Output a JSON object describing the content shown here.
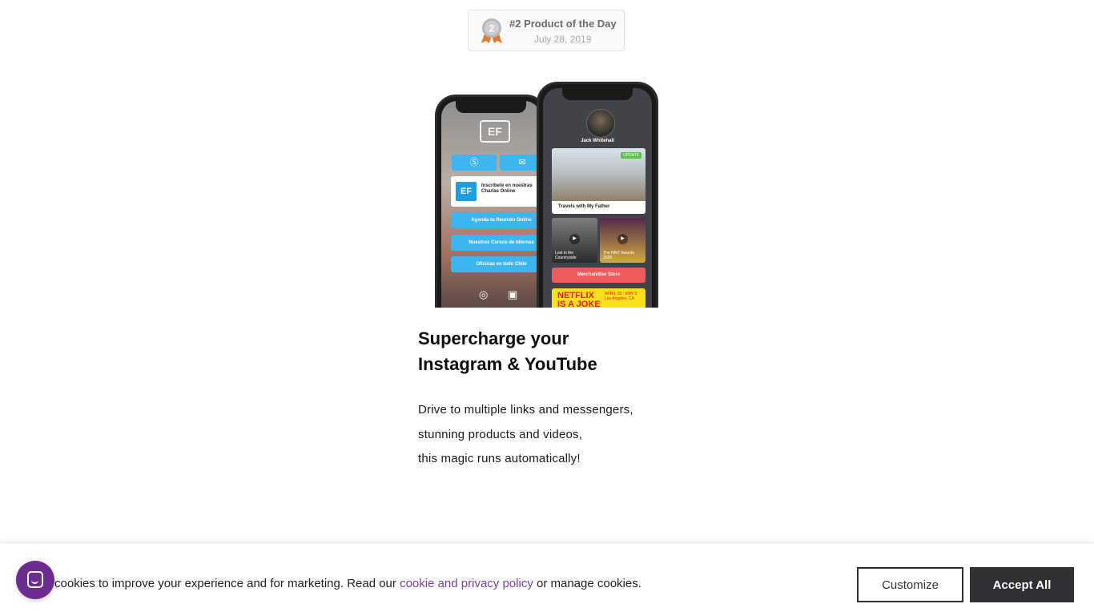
{
  "badge": {
    "title": "#2 Product of the Day",
    "date": "July 28, 2019",
    "rank": "2",
    "icon": "medal-icon",
    "medal_color": "#b9b9b9",
    "ribbon_color": "#e07b2e"
  },
  "phone_back": {
    "logo": "EF",
    "promo_logo": "EF",
    "promo_text": "Inscríbete en nuestras Charlas Online",
    "links": [
      "Agenda tu Reunión Online",
      "Nuestros Cursos de Idiomas",
      "Oficinas en todo Chile"
    ],
    "icons": [
      "skype-icon",
      "mail-icon",
      "instagram-icon",
      "facebook-icon"
    ],
    "button_color": "#3fb5f0"
  },
  "phone_front": {
    "profile_name": "Jack Whitehall",
    "card_title": "Travels with My Father",
    "card_tag": "UPDATE",
    "tiles": [
      "Lost in the Countryside",
      "The NBIT Awards 2020"
    ],
    "merch_label": "Merchandise Store",
    "merch_color": "#ef5a5a",
    "netflix_title": "NETFLIX IS A JOKE FEST",
    "netflix_detail": "APRIL 28 - MAY 3 Los Angeles, CA"
  },
  "headline": {
    "line1": "Supercharge your",
    "line2": "Instagram & YouTube"
  },
  "body": {
    "line1": "Drive to multiple links and messengers,",
    "line2": "stunning products and videos,",
    "line3": "this magic runs automatically!"
  },
  "cookie_bar": {
    "text_before": "se cookies to improve your experience and for marketing. Read our ",
    "link_text": "cookie and privacy policy",
    "text_after": " or manage cookies.",
    "customize_label": "Customize",
    "accept_label": "Accept All",
    "link_color": "#7b3fa5",
    "accept_color": "#2f3033"
  },
  "chat": {
    "icon": "chat-icon",
    "color": "#6d2c8f"
  }
}
